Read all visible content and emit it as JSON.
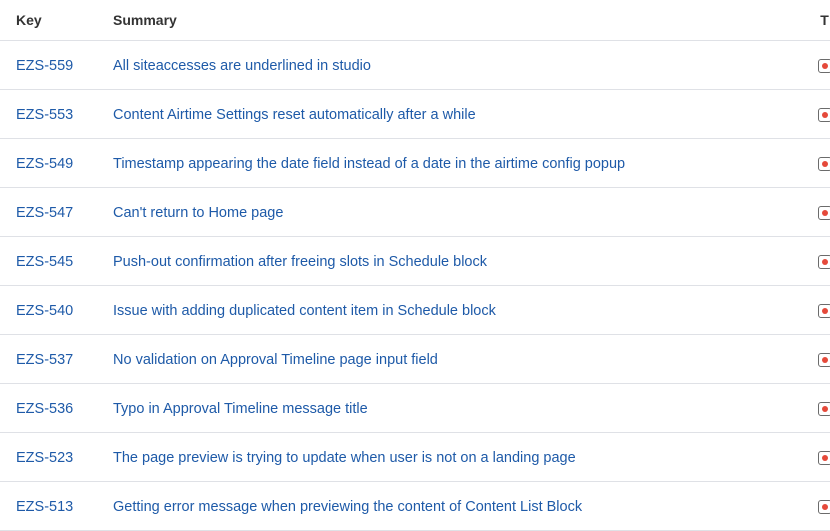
{
  "table": {
    "headers": {
      "key": "Key",
      "summary": "Summary",
      "type": "T"
    },
    "rows": [
      {
        "key": "EZS-559",
        "summary": "All siteaccesses are underlined in studio",
        "type_icon": "bug-icon"
      },
      {
        "key": "EZS-553",
        "summary": "Content Airtime Settings reset automatically after a while",
        "type_icon": "bug-icon"
      },
      {
        "key": "EZS-549",
        "summary": "Timestamp appearing the date field instead of a date in the airtime config popup",
        "type_icon": "bug-icon"
      },
      {
        "key": "EZS-547",
        "summary": "Can't return to Home page",
        "type_icon": "bug-icon"
      },
      {
        "key": "EZS-545",
        "summary": "Push-out confirmation after freeing slots in Schedule block",
        "type_icon": "bug-icon"
      },
      {
        "key": "EZS-540",
        "summary": "Issue with adding duplicated content item in Schedule block",
        "type_icon": "bug-icon"
      },
      {
        "key": "EZS-537",
        "summary": "No validation on Approval Timeline page input field",
        "type_icon": "bug-icon"
      },
      {
        "key": "EZS-536",
        "summary": "Typo in Approval Timeline message title",
        "type_icon": "bug-icon"
      },
      {
        "key": "EZS-523",
        "summary": "The page preview is trying to update when user is not on a landing page",
        "type_icon": "bug-icon"
      },
      {
        "key": "EZS-513",
        "summary": "Getting error message when previewing the content of Content List Block",
        "type_icon": "bug-icon"
      }
    ]
  },
  "colors": {
    "link": "#1e5aa8",
    "header_text": "#333333",
    "row_divider": "#dfe1e6",
    "bug_dot": "#e5493a"
  }
}
